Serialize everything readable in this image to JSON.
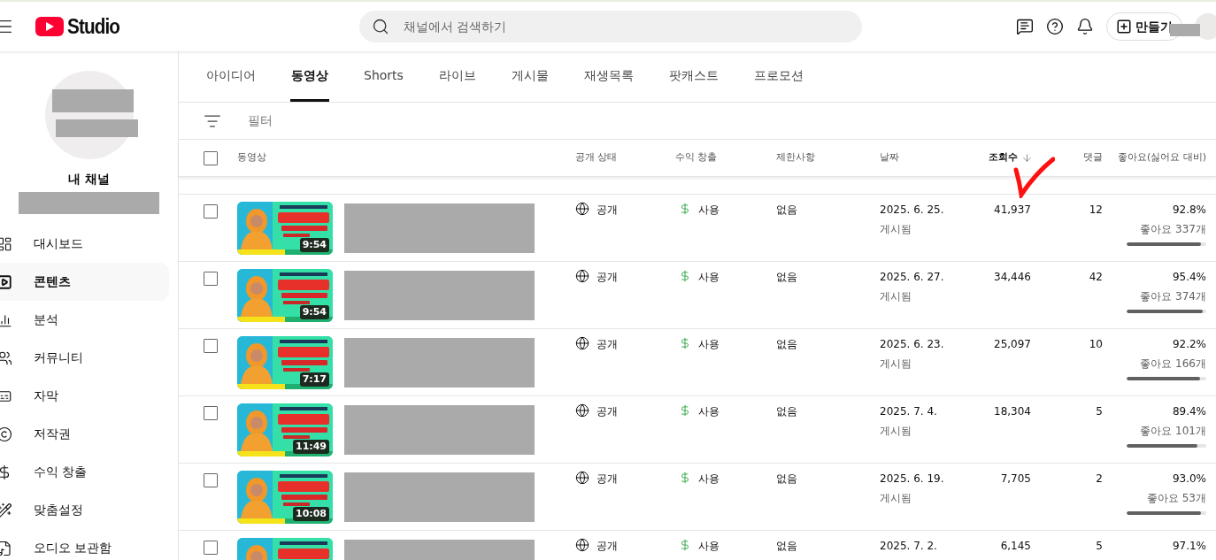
{
  "header": {
    "logo_text": "Studio",
    "search": {
      "placeholder": "채널에서 검색하기"
    },
    "create_button": "만들기"
  },
  "sidebar": {
    "channel_label": "내 채널",
    "items": [
      {
        "label": "대시보드",
        "selected": false
      },
      {
        "label": "콘텐츠",
        "selected": true
      },
      {
        "label": "분석",
        "selected": false
      },
      {
        "label": "커뮤니티",
        "selected": false
      },
      {
        "label": "자막",
        "selected": false
      },
      {
        "label": "저작권",
        "selected": false
      },
      {
        "label": "수익 창출",
        "selected": false
      },
      {
        "label": "맞춤설정",
        "selected": false
      },
      {
        "label": "오디오 보관함",
        "selected": false
      }
    ]
  },
  "tabs": [
    {
      "label": "아이디어",
      "selected": false
    },
    {
      "label": "동영상",
      "selected": true
    },
    {
      "label": "Shorts",
      "selected": false
    },
    {
      "label": "라이브",
      "selected": false
    },
    {
      "label": "게시물",
      "selected": false
    },
    {
      "label": "재생목록",
      "selected": false
    },
    {
      "label": "팟캐스트",
      "selected": false
    },
    {
      "label": "프로모션",
      "selected": false
    }
  ],
  "filter": {
    "placeholder": "필터"
  },
  "table": {
    "select_all_checked": false,
    "columns": [
      {
        "label": "동영상",
        "sorted": false
      },
      {
        "label": "공개 상태",
        "sorted": false
      },
      {
        "label": "수익 창출",
        "sorted": false
      },
      {
        "label": "제한사항",
        "sorted": false
      },
      {
        "label": "날짜",
        "sorted": false
      },
      {
        "label": "조회수",
        "sorted": true
      },
      {
        "label": "댓글",
        "sorted": false
      },
      {
        "label": "좋아요(싫어요 대비)",
        "sorted": false
      }
    ],
    "rows": [
      {
        "checked": false,
        "duration": "9:54",
        "visibility": "공개",
        "monetization": "사용",
        "restrictions": "없음",
        "date": "2025. 6. 25.",
        "status": "게시됨",
        "views": "41,937",
        "comments": "12",
        "likes_pct": "92.8%",
        "likes_count": "좋아요 337개",
        "level": 0.928
      },
      {
        "checked": false,
        "duration": "9:54",
        "visibility": "공개",
        "monetization": "사용",
        "restrictions": "없음",
        "date": "2025. 6. 27.",
        "status": "게시됨",
        "views": "34,446",
        "comments": "42",
        "likes_pct": "95.4%",
        "likes_count": "좋아요 374개",
        "level": 0.954
      },
      {
        "checked": false,
        "duration": "7:17",
        "visibility": "공개",
        "monetization": "사용",
        "restrictions": "없음",
        "date": "2025. 6. 23.",
        "status": "게시됨",
        "views": "25,097",
        "comments": "10",
        "likes_pct": "92.2%",
        "likes_count": "좋아요 166개",
        "level": 0.922
      },
      {
        "checked": false,
        "duration": "11:49",
        "visibility": "공개",
        "monetization": "사용",
        "restrictions": "없음",
        "date": "2025. 7. 4.",
        "status": "게시됨",
        "views": "18,304",
        "comments": "5",
        "likes_pct": "89.4%",
        "likes_count": "좋아요 101개",
        "level": 0.894
      },
      {
        "checked": false,
        "duration": "10:08",
        "visibility": "공개",
        "monetization": "사용",
        "restrictions": "없음",
        "date": "2025. 6. 19.",
        "status": "게시됨",
        "views": "7,705",
        "comments": "2",
        "likes_pct": "93.0%",
        "likes_count": "좋아요 53개",
        "level": 0.93
      },
      {
        "checked": false,
        "visibility": "공개",
        "monetization": "사용",
        "restrictions": "없음",
        "date": "2025. 7. 2.",
        "views": "6,145",
        "comments": "5",
        "likes_pct": "97.1%"
      }
    ]
  }
}
